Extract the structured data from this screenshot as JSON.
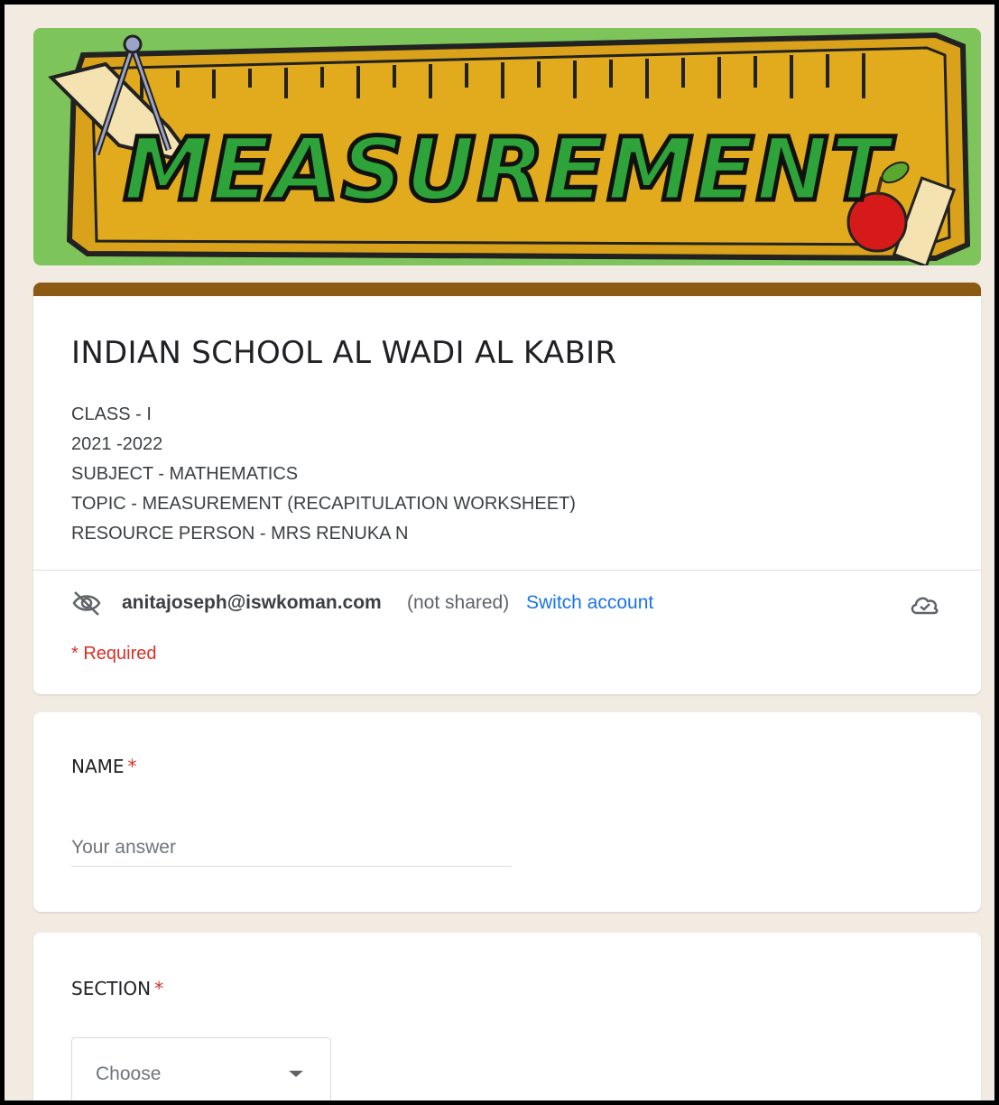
{
  "banner": {
    "word": "MEASUREMENT"
  },
  "form": {
    "title": "INDIAN SCHOOL AL WADI AL KABIR",
    "description": [
      "CLASS - I",
      "2021 -2022",
      "SUBJECT - MATHEMATICS",
      "TOPIC - MEASUREMENT (RECAPITULATION WORKSHEET)",
      "RESOURCE PERSON - MRS RENUKA N"
    ],
    "account": {
      "email": "anitajoseph@iswkoman.com",
      "not_shared": "(not shared)",
      "switch_label": "Switch account"
    },
    "required_note": "* Required"
  },
  "questions": [
    {
      "label": "NAME",
      "required_mark": "*",
      "placeholder": "Your answer"
    },
    {
      "label": "SECTION",
      "required_mark": "*",
      "dropdown_value": "Choose"
    }
  ],
  "colors": {
    "page_bg": "#f1ebe2",
    "accent_bar": "#8b5a13",
    "required": "#d93025",
    "link": "#1a73e8",
    "banner_green": "#7dc55a"
  }
}
